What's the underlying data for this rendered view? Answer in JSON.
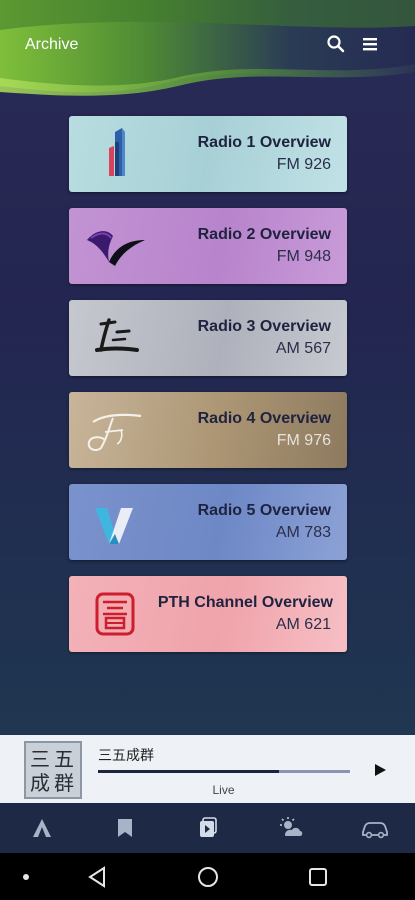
{
  "header": {
    "title": "Archive",
    "icons": [
      "search-icon",
      "menu-icon"
    ]
  },
  "stations": [
    {
      "title": "Radio 1 Overview",
      "frequency": "FM 926",
      "logo": "radio-1-logo-icon"
    },
    {
      "title": "Radio 2 Overview",
      "frequency": "FM 948",
      "logo": "radio-2-logo-icon"
    },
    {
      "title": "Radio 3 Overview",
      "frequency": "AM 567",
      "logo": "radio-3-logo-icon"
    },
    {
      "title": "Radio 4 Overview",
      "frequency": "FM 976",
      "logo": "radio-4-logo-icon"
    },
    {
      "title": "Radio 5 Overview",
      "frequency": "AM 783",
      "logo": "radio-5-logo-icon"
    },
    {
      "title": "PTH Channel Overview",
      "frequency": "AM 621",
      "logo": "pth-seal-icon"
    }
  ],
  "player": {
    "album_chars": [
      "三",
      "五",
      "成",
      "群"
    ],
    "track_title": "三五成群",
    "status": "Live",
    "progress": 0.72
  },
  "tabs": [
    "home-icon",
    "bookmark-icon",
    "playlist-icon",
    "weather-icon",
    "traffic-car-icon"
  ],
  "colors": {
    "accent_green": "#7fbf3a",
    "player_background": "#eef2f6",
    "tabbar_background": "#1e2a45"
  }
}
